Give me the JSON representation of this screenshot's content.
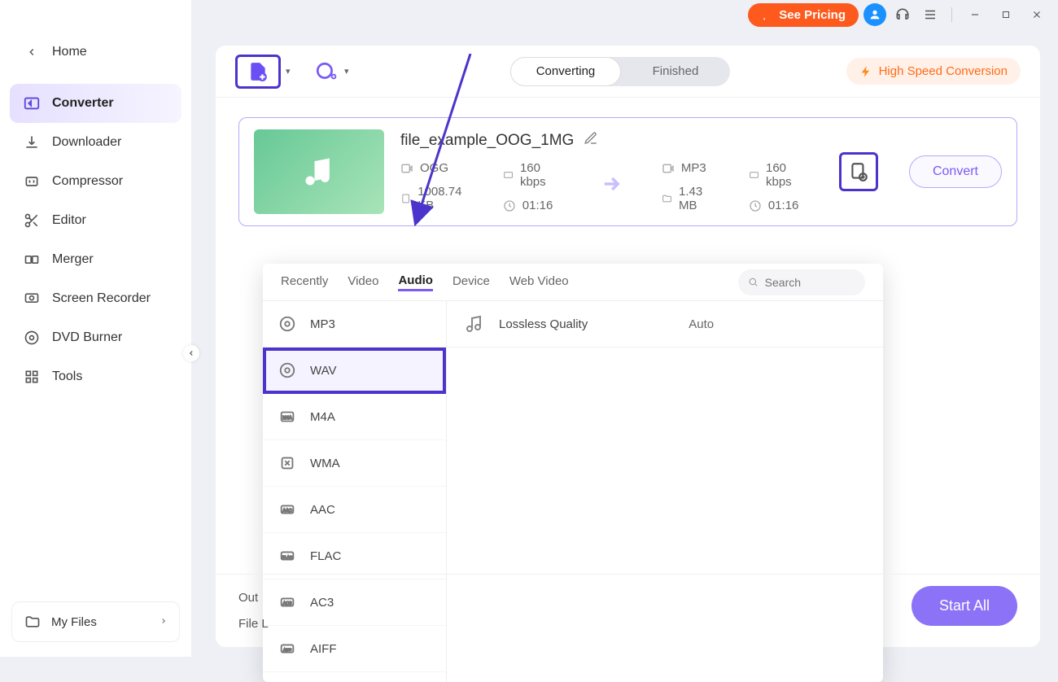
{
  "titlebar": {
    "pricing_label": "See Pricing"
  },
  "sidebar": {
    "items": [
      {
        "label": "Home"
      },
      {
        "label": "Converter"
      },
      {
        "label": "Downloader"
      },
      {
        "label": "Compressor"
      },
      {
        "label": "Editor"
      },
      {
        "label": "Merger"
      },
      {
        "label": "Screen Recorder"
      },
      {
        "label": "DVD Burner"
      },
      {
        "label": "Tools"
      }
    ],
    "my_files": "My Files"
  },
  "toolbar": {
    "tabs": {
      "converting": "Converting",
      "finished": "Finished"
    },
    "highspeed": "High Speed Conversion"
  },
  "file": {
    "name": "file_example_OOG_1MG",
    "src_format": "OGG",
    "src_bitrate": "160 kbps",
    "src_size": "1008.74 KB",
    "src_duration": "01:16",
    "dst_format": "MP3",
    "dst_bitrate": "160 kbps",
    "dst_size": "1.43 MB",
    "dst_duration": "01:16",
    "convert_label": "Convert"
  },
  "format_popup": {
    "tabs": [
      "Recently",
      "Video",
      "Audio",
      "Device",
      "Web Video"
    ],
    "search_placeholder": "Search",
    "formats": [
      "MP3",
      "WAV",
      "M4A",
      "WMA",
      "AAC",
      "FLAC",
      "AC3",
      "AIFF"
    ],
    "quality_label": "Lossless Quality",
    "quality_auto": "Auto"
  },
  "bottom": {
    "output_label": "Out",
    "file_label": "File L",
    "start_all": "Start All"
  }
}
